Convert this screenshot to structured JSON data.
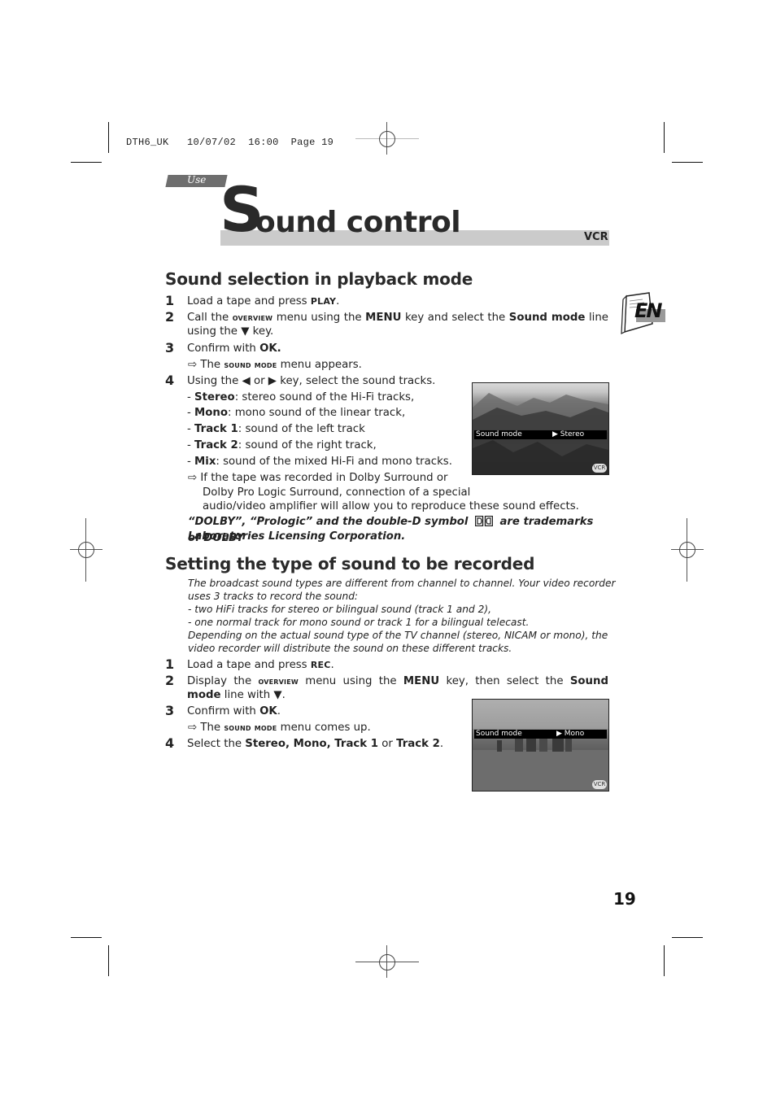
{
  "print_header": {
    "file": "DTH6_UK",
    "date": "10/07/02",
    "time": "16:00",
    "page_label": "Page 19"
  },
  "section_tab": "Use",
  "title": {
    "initial": "S",
    "rest": "ound control",
    "tag": "VCR"
  },
  "language_badge": "EN",
  "playback": {
    "heading": "Sound selection in playback mode",
    "steps": [
      {
        "num": "1",
        "parts": [
          "Load a tape and press ",
          "PLAY",
          "."
        ]
      },
      {
        "num": "2",
        "parts": [
          "Call the ",
          "overview",
          " menu using the ",
          "MENU",
          " key and select the ",
          "Sound mode",
          " line using the ",
          "▼",
          " key."
        ]
      },
      {
        "num": "3",
        "parts": [
          "Confirm with ",
          "OK."
        ]
      },
      {
        "num": "",
        "parts": [
          "⇨ The ",
          "sound mode",
          " menu appears."
        ]
      },
      {
        "num": "4",
        "parts": [
          "Using the ",
          "◀",
          " or ",
          "▶",
          " key, select the sound tracks."
        ]
      }
    ],
    "options": [
      {
        "name": "Stereo",
        "desc": ": stereo sound of the Hi-Fi tracks,"
      },
      {
        "name": "Mono",
        "desc": ": mono sound of the linear track,"
      },
      {
        "name": "Track 1",
        "desc": ": sound of the left track"
      },
      {
        "name": "Track 2",
        "desc": ": sound of the right track,"
      },
      {
        "name": "Mix",
        "desc": ": sound of the mixed Hi-Fi and mono tracks."
      }
    ],
    "dolby_note_l1": "⇨ If the tape was recorded in Dolby Surround or",
    "dolby_note_l2": "Dolby Pro Logic Surround, connection of a special",
    "dolby_note_l3": "audio/video amplifier will allow you to reproduce these sound effects.",
    "trademark_l1a": "“DOLBY”, “Prologic” and the double-D symbol",
    "trademark_l1b": "are trademarks of DOLBY",
    "trademark_l2": "Laboratories Licensing Corporation.",
    "screen": {
      "osd_label": "Sound mode",
      "osd_value": "▶ Stereo",
      "badge": "VCR"
    }
  },
  "recording": {
    "heading": "Setting the type of sound to be recorded",
    "intro": [
      "The broadcast sound types are different from channel to channel. Your video recorder",
      "uses 3 tracks to record the sound:",
      "- two HiFi tracks for stereo or bilingual sound (track 1 and 2),",
      "- one normal track for mono sound or track 1 for a bilingual telecast.",
      "Depending on the actual sound type of the TV channel (stereo, NICAM or mono), the",
      "video recorder will distribute the sound on these different tracks."
    ],
    "steps": [
      {
        "num": "1",
        "parts": [
          "Load a tape and press ",
          "REC",
          "."
        ]
      },
      {
        "num": "2",
        "parts": [
          "Display the ",
          "overview",
          " menu using the ",
          "MENU",
          " key, then select the ",
          "Sound mode",
          " line with ",
          "▼",
          "."
        ]
      },
      {
        "num": "3",
        "parts": [
          "Confirm with ",
          "OK",
          "."
        ]
      },
      {
        "num": "",
        "parts": [
          "⇨ The ",
          "sound mode",
          " menu comes up."
        ]
      },
      {
        "num": "4",
        "parts": [
          "Select the ",
          "Stereo, Mono, Track 1",
          " or ",
          "Track 2",
          "."
        ]
      }
    ],
    "screen": {
      "osd_label": "Sound mode",
      "osd_value": "▶  Mono",
      "badge": "VCR"
    }
  },
  "page_number": "19"
}
